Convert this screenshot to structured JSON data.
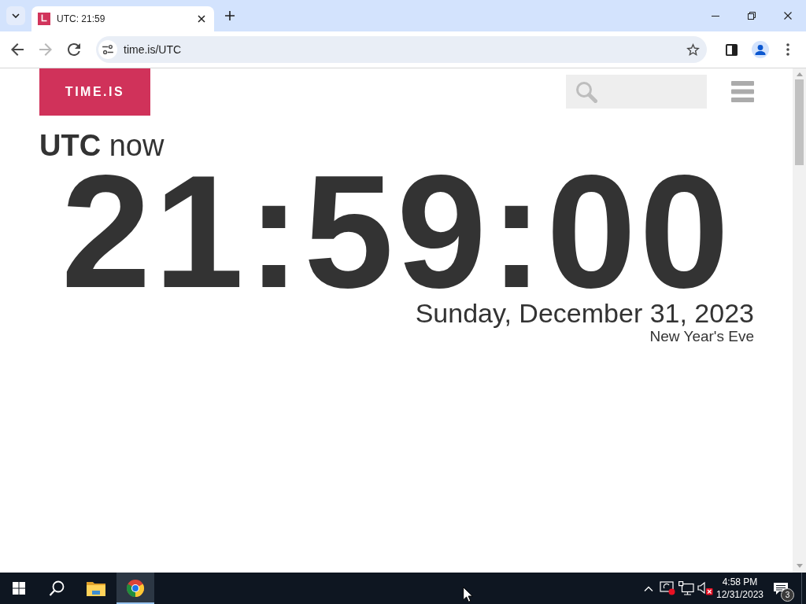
{
  "browser": {
    "tabs": [
      {
        "title": "UTC: 21:59",
        "selected": true
      }
    ],
    "nav_buttons": [
      {
        "kind": "back",
        "disabled": false
      },
      {
        "kind": "forward",
        "disabled": true
      },
      {
        "kind": "reload",
        "disabled": false
      }
    ],
    "address": "time.is/UTC"
  },
  "page": {
    "logo": "TIME.IS",
    "heading": "**UTC** now",
    "clock": "21:59:00",
    "date": "Sunday, December 31, 2023",
    "holiday": "New Year's Eve"
  },
  "taskbar": {
    "apps": [
      {
        "kind": "file-explorer",
        "active": false
      },
      {
        "kind": "browser",
        "active": true
      }
    ],
    "tray": {
      "volume_muted": true,
      "time": "4:58 PM",
      "date": "12/31/2023",
      "notification_count": "3"
    }
  }
}
